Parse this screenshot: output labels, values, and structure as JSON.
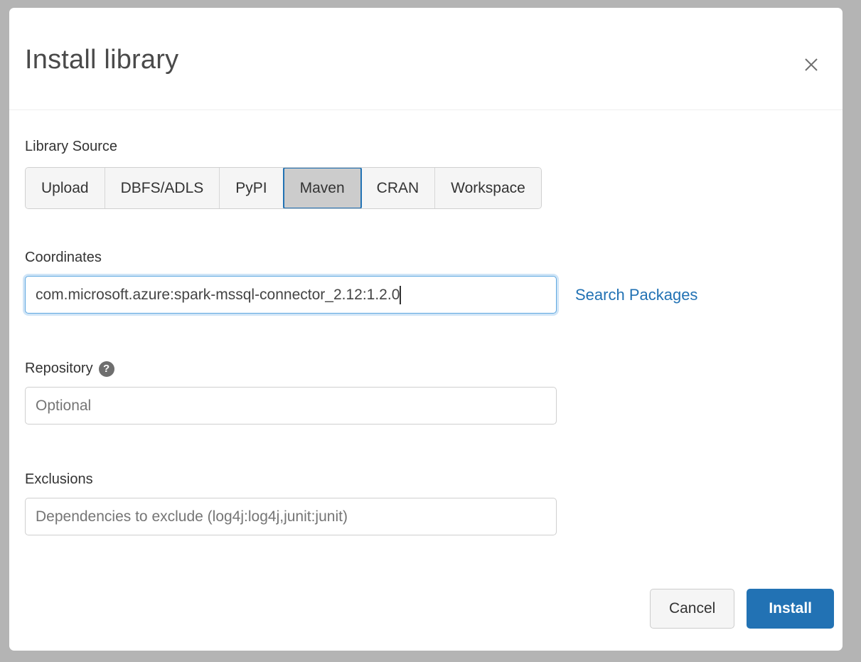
{
  "dialog": {
    "title": "Install library",
    "close_icon": "close-icon"
  },
  "library_source": {
    "label": "Library Source",
    "selected": "Maven",
    "tabs": [
      {
        "label": "Upload",
        "selected": false
      },
      {
        "label": "DBFS/ADLS",
        "selected": false
      },
      {
        "label": "PyPI",
        "selected": false
      },
      {
        "label": "Maven",
        "selected": true
      },
      {
        "label": "CRAN",
        "selected": false
      },
      {
        "label": "Workspace",
        "selected": false
      }
    ]
  },
  "coordinates": {
    "label": "Coordinates",
    "value": "com.microsoft.azure:spark-mssql-connector_2.12:1.2.0",
    "placeholder": "",
    "focused": true,
    "search_link": "Search Packages"
  },
  "repository": {
    "label": "Repository",
    "help_icon": "help-icon",
    "value": "",
    "placeholder": "Optional"
  },
  "exclusions": {
    "label": "Exclusions",
    "value": "",
    "placeholder": "Dependencies to exclude (log4j:log4j,junit:junit)"
  },
  "footer": {
    "cancel_label": "Cancel",
    "install_label": "Install"
  },
  "colors": {
    "accent": "#2272b4",
    "backdrop": "#b4b4b4",
    "selected_tab_bg": "#cccccc",
    "input_border": "#cfcfcf"
  }
}
